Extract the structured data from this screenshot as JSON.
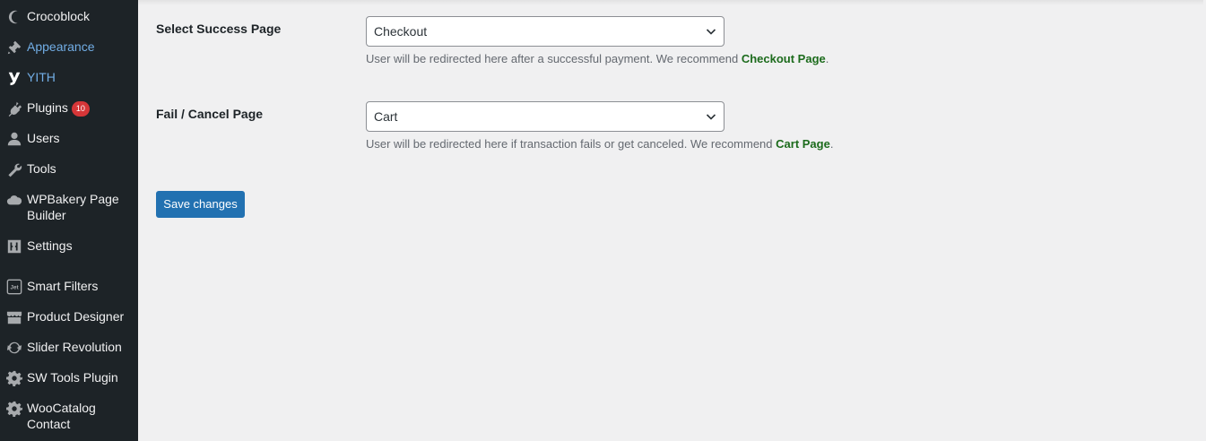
{
  "sidebar": {
    "items": [
      {
        "label": "Crocoblock",
        "icon": "crocoblock-icon"
      },
      {
        "label": "Appearance",
        "icon": "brush-icon"
      },
      {
        "label": "YITH",
        "icon": "yith-icon"
      },
      {
        "label": "Plugins",
        "icon": "plugin-icon",
        "badge": "10"
      },
      {
        "label": "Users",
        "icon": "user-icon"
      },
      {
        "label": "Tools",
        "icon": "wrench-icon"
      },
      {
        "label": "WPBakery Page Builder",
        "icon": "cloud-icon"
      },
      {
        "label": "Settings",
        "icon": "sliders-icon"
      },
      {
        "label": "Smart Filters",
        "icon": "jet-icon"
      },
      {
        "label": "Product Designer",
        "icon": "store-icon"
      },
      {
        "label": "Slider Revolution",
        "icon": "refresh-icon"
      },
      {
        "label": "SW Tools Plugin",
        "icon": "gear-icon"
      },
      {
        "label": "WooCatalog Contact",
        "icon": "gear-icon"
      }
    ]
  },
  "form": {
    "success": {
      "label": "Select Success Page",
      "value": "Checkout",
      "desc_text": "User will be redirected here after a successful payment. We recommend ",
      "desc_link": "Checkout Page",
      "desc_end": "."
    },
    "fail": {
      "label": "Fail / Cancel Page",
      "value": "Cart",
      "desc_text": "User will be redirected here if transaction fails or get canceled. We recommend ",
      "desc_link": "Cart Page",
      "desc_end": "."
    },
    "save_label": "Save changes"
  },
  "colors": {
    "sidebar_bg": "#1d2327",
    "highlight": "#72aee6",
    "primary": "#2271b1",
    "badge": "#d63638",
    "recommend": "#1c6b1c"
  }
}
